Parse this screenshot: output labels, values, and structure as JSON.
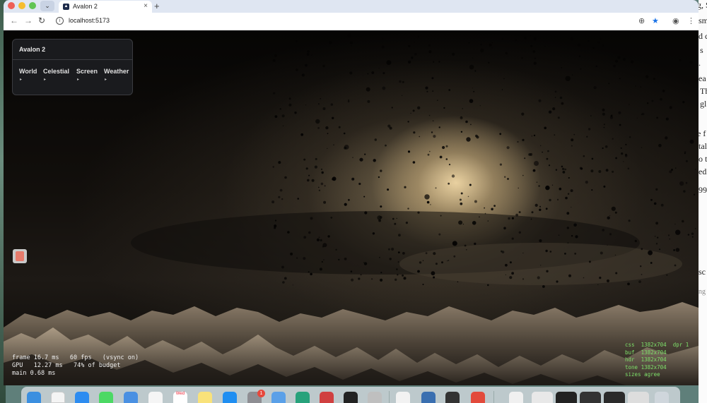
{
  "browser": {
    "tab_title": "Avalon 2",
    "tab_close": "×",
    "new_tab": "+",
    "tab_dropdown": "⌄",
    "url": "localhost:5173"
  },
  "panel": {
    "title": "Avalon 2",
    "menu": [
      {
        "label": "World",
        "caret": "▸"
      },
      {
        "label": "Celestial",
        "caret": "▸"
      },
      {
        "label": "Screen",
        "caret": "▸"
      },
      {
        "label": "Weather",
        "caret": "▸"
      }
    ]
  },
  "stats": {
    "line1": "frame 16.7 ms   60 fps   (vsync on)",
    "line2": "GPU   12.27 ms   74% of budget",
    "line3": "main 0.68 ms"
  },
  "sizes": {
    "line1": "css  1382x704  dpr 1",
    "line2": "buf  1382x704",
    "line3": "hdr  1382x704",
    "line4": "tone 1382x704",
    "line5": "sizes agree"
  },
  "dock": {
    "calendar_month": "Wed",
    "calendar_day": "5",
    "badge_count": "1"
  },
  "background_doc": [
    "g, S",
    "sm",
    "d c",
    "s",
    ".",
    "ea",
    "Th",
    "gl",
    "e f",
    "tal",
    "o t",
    "ed",
    "99",
    "sc",
    "ng"
  ],
  "colors": {
    "sizes_text": "#7ee06a",
    "stats_text": "#f0f0f0",
    "panel_bg": "#1c1d21"
  }
}
